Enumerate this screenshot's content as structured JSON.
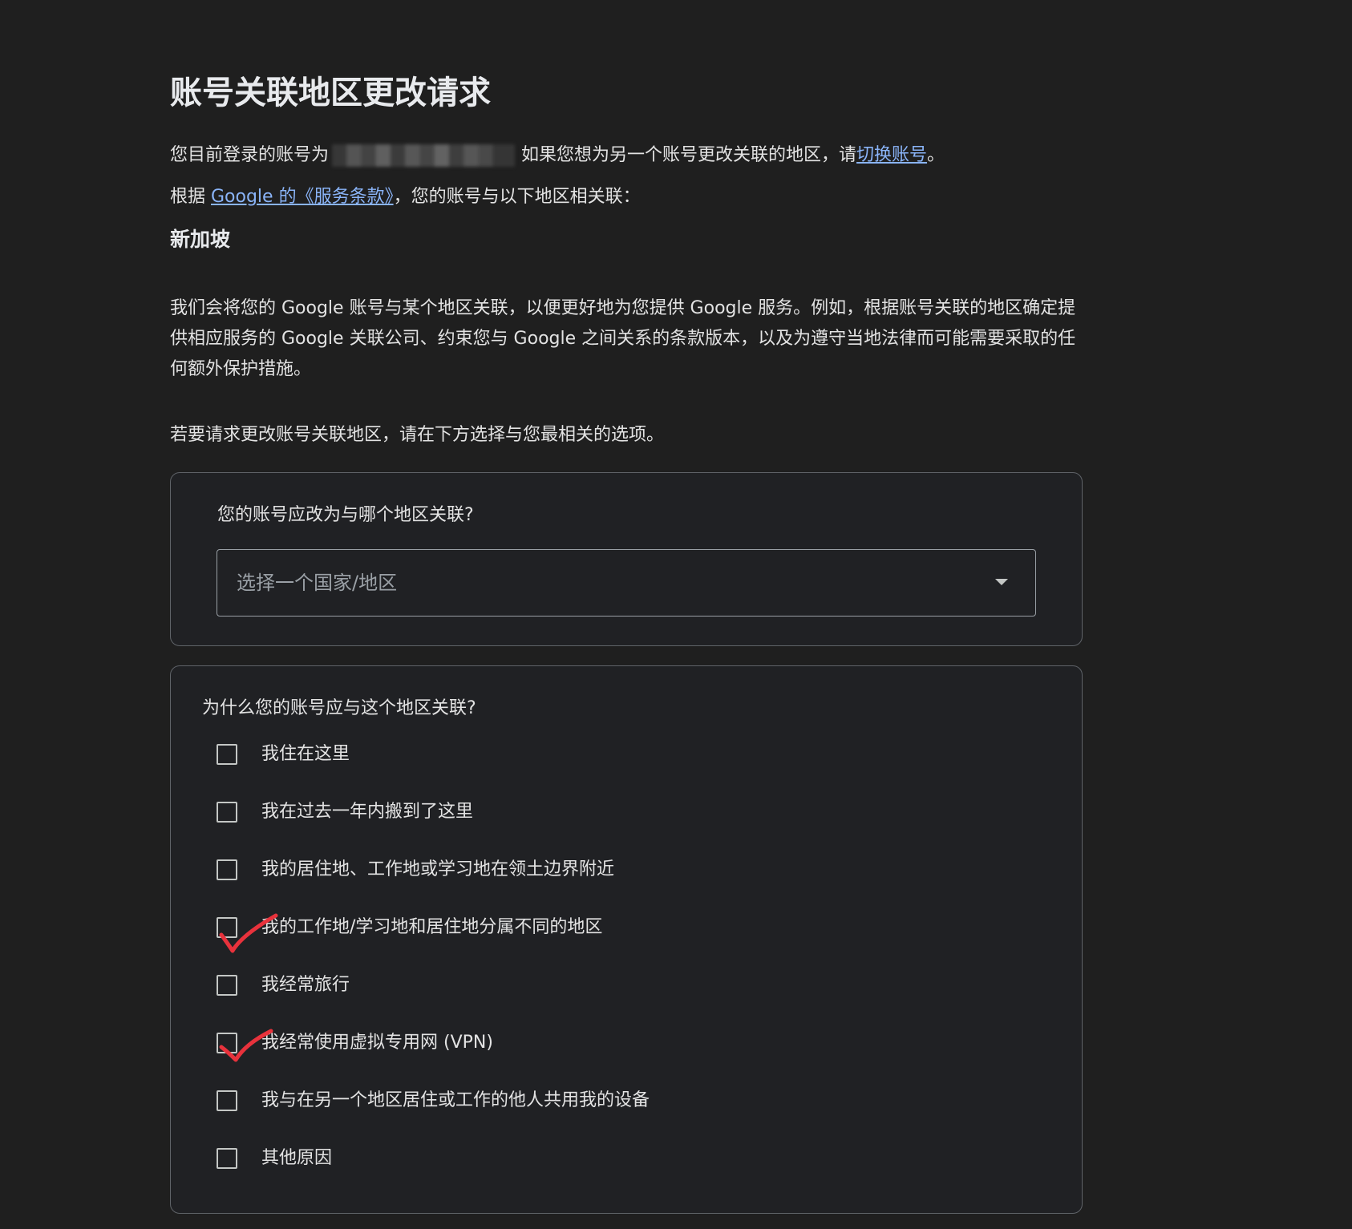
{
  "page": {
    "title": "账号关联地区更改请求",
    "line1_prefix": "您目前登录的账号为",
    "line1_middle": "如果您想为另一个账号更改关联的地区，请",
    "line1_link": "切换账号",
    "line1_suffix": "。",
    "line2_prefix": "根据 ",
    "line2_link": "Google 的《服务条款》",
    "line2_suffix": "，您的账号与以下地区相关联：",
    "current_region": "新加坡",
    "explanation": "我们会将您的 Google 账号与某个地区关联，以便更好地为您提供 Google 服务。例如，根据账号关联的地区确定提供相应服务的 Google 关联公司、约束您与 Google 之间关系的条款版本，以及为遵守当地法律而可能需要采取的任何额外保护措施。",
    "instruction": "若要请求更改账号关联地区，请在下方选择与您最相关的选项。"
  },
  "region_card": {
    "question": "您的账号应改为与哪个地区关联?",
    "select_placeholder": "选择一个国家/地区"
  },
  "reason_card": {
    "question": "为什么您的账号应与这个地区关联?",
    "options": [
      {
        "label": "我住在这里",
        "hand_checked": false
      },
      {
        "label": "我在过去一年内搬到了这里",
        "hand_checked": false
      },
      {
        "label": "我的居住地、工作地或学习地在领土边界附近",
        "hand_checked": false
      },
      {
        "label": "我的工作地/学习地和居住地分属不同的地区",
        "hand_checked": true
      },
      {
        "label": "我经常旅行",
        "hand_checked": false
      },
      {
        "label": "我经常使用虚拟专用网 (VPN)",
        "hand_checked": true
      },
      {
        "label": "我与在另一个地区居住或工作的他人共用我的设备",
        "hand_checked": false
      },
      {
        "label": "其他原因",
        "hand_checked": false
      }
    ]
  },
  "colors": {
    "background": "#1f1f1f",
    "card": "#202124",
    "link": "#8ab4f8",
    "annotation": "#e8323c"
  }
}
